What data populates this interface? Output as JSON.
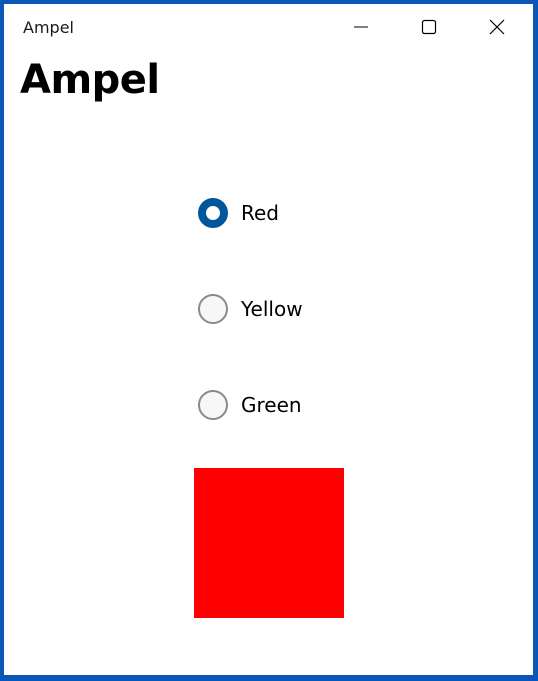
{
  "window": {
    "title": "Ampel"
  },
  "page": {
    "heading": "Ampel"
  },
  "radios": [
    {
      "label": "Red",
      "checked": true
    },
    {
      "label": "Yellow",
      "checked": false
    },
    {
      "label": "Green",
      "checked": false
    }
  ],
  "light": {
    "color": "#ff0000"
  },
  "colors": {
    "accent": "#00579c",
    "window_border": "#0b57b8"
  }
}
